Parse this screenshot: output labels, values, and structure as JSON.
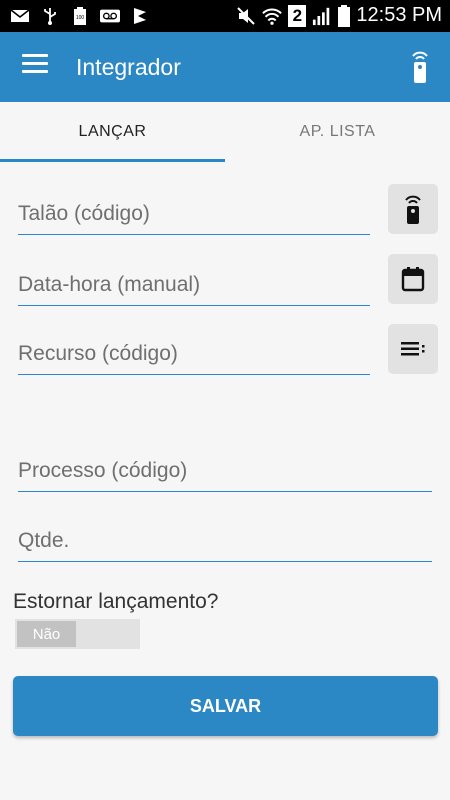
{
  "status_bar": {
    "time": "12:53 PM",
    "battery_label": "100",
    "sim_badge": "2",
    "icons": [
      "mail-icon",
      "usb-icon",
      "battery-100-icon",
      "voicemail-icon",
      "app-notification-icon",
      "mute-icon",
      "wifi-icon",
      "sim-2-icon",
      "signal-icon",
      "battery-icon"
    ]
  },
  "app_bar": {
    "title": "Integrador",
    "menu_icon": "menu-icon",
    "action_icon": "remote-control-icon"
  },
  "tabs": [
    {
      "label": "LANÇAR",
      "active": true
    },
    {
      "label": "AP. LISTA",
      "active": false
    }
  ],
  "form": {
    "talao_placeholder": "Talão (código)",
    "datahora_placeholder": "Data-hora (manual)",
    "recurso_placeholder": "Recurso (código)",
    "processo_placeholder": "Processo (código)",
    "qtde_placeholder": "Qtde.",
    "estornar_label": "Estornar lançamento?",
    "toggle_value": "Não",
    "save_label": "SALVAR"
  },
  "colors": {
    "primary": "#2c87c5",
    "background": "#f6f6f6",
    "side_button": "#e2e2e2"
  }
}
